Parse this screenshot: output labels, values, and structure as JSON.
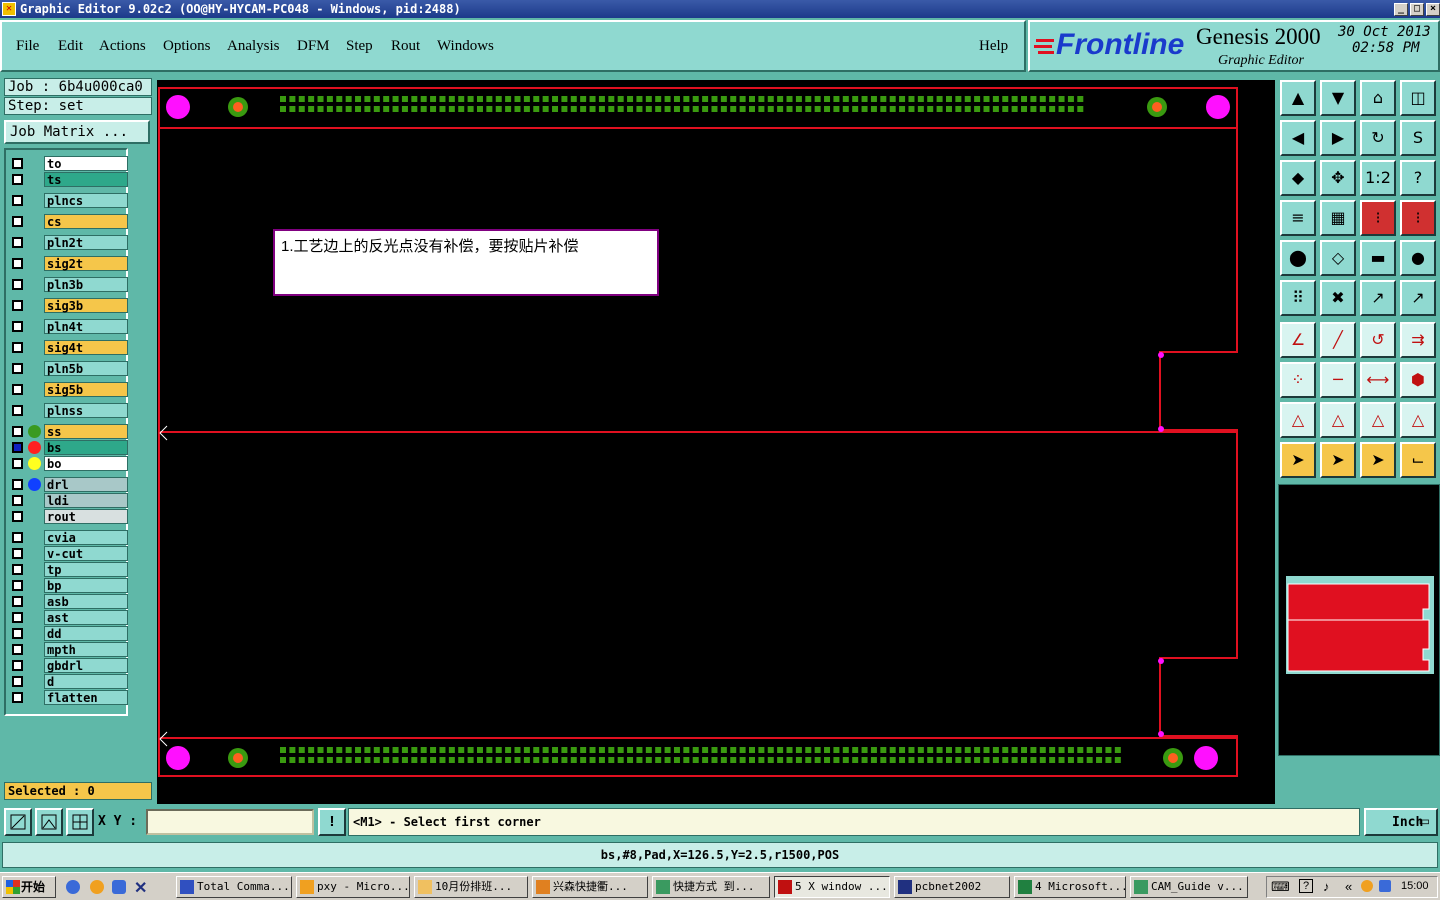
{
  "window": {
    "title": "Graphic Editor 9.02c2 (OO@HY-HYCAM-PC048 - Windows, pid:2488)"
  },
  "menu": {
    "items": [
      "File",
      "Edit",
      "Actions",
      "Options",
      "Analysis",
      "DFM",
      "Step",
      "Rout",
      "Windows"
    ],
    "help": "Help"
  },
  "brand": {
    "logo": "Frontline",
    "product": "Genesis 2000",
    "subtitle": "Graphic Editor",
    "date": "30 Oct 2013",
    "time": "02:58 PM"
  },
  "job": {
    "job_line": "Job :  6b4u000ca0",
    "step_line": "Step:  set",
    "matrix_button": "Job Matrix ..."
  },
  "layers": [
    {
      "name": "to",
      "color": "#ffffff",
      "dot": ""
    },
    {
      "name": "ts",
      "color": "#2ea88a",
      "dot": ""
    },
    {
      "name": "plncs",
      "color": "#8fd9d0",
      "dot": ""
    },
    {
      "name": "cs",
      "color": "#f5c64a",
      "dot": ""
    },
    {
      "name": "pln2t",
      "color": "#8fd9d0",
      "dot": ""
    },
    {
      "name": "sig2t",
      "color": "#f5c64a",
      "dot": ""
    },
    {
      "name": "pln3b",
      "color": "#8fd9d0",
      "dot": ""
    },
    {
      "name": "sig3b",
      "color": "#f5c64a",
      "dot": ""
    },
    {
      "name": "pln4t",
      "color": "#8fd9d0",
      "dot": ""
    },
    {
      "name": "sig4t",
      "color": "#f5c64a",
      "dot": ""
    },
    {
      "name": "pln5b",
      "color": "#8fd9d0",
      "dot": ""
    },
    {
      "name": "sig5b",
      "color": "#f5c64a",
      "dot": ""
    },
    {
      "name": "plnss",
      "color": "#8fd9d0",
      "dot": ""
    },
    {
      "name": "ss",
      "color": "#f5c64a",
      "dot": "#3a9a20"
    },
    {
      "name": "bs",
      "color": "#2ea88a",
      "dot": "#ff2020"
    },
    {
      "name": "bo",
      "color": "#ffffff",
      "dot": "#ffff20"
    },
    {
      "name": "drl",
      "color": "#a8c8c8",
      "dot": "#1040ff"
    },
    {
      "name": "ldi",
      "color": "#a8c8c8",
      "dot": ""
    },
    {
      "name": "rout",
      "color": "#d8e0e0",
      "dot": ""
    },
    {
      "name": "cvia",
      "color": "#8fd9d0",
      "dot": ""
    },
    {
      "name": "v-cut",
      "color": "#8fd9d0",
      "dot": ""
    },
    {
      "name": "tp",
      "color": "#8fd9d0",
      "dot": ""
    },
    {
      "name": "bp",
      "color": "#8fd9d0",
      "dot": ""
    },
    {
      "name": "asb",
      "color": "#8fd9d0",
      "dot": ""
    },
    {
      "name": "ast",
      "color": "#8fd9d0",
      "dot": ""
    },
    {
      "name": "dd",
      "color": "#8fd9d0",
      "dot": ""
    },
    {
      "name": "mpth",
      "color": "#8fd9d0",
      "dot": ""
    },
    {
      "name": "gbdrl",
      "color": "#8fd9d0",
      "dot": ""
    },
    {
      "name": "d",
      "color": "#8fd9d0",
      "dot": ""
    },
    {
      "name": "flatten",
      "color": "#8fd9d0",
      "dot": ""
    }
  ],
  "selected": "Selected : 0",
  "note": "1.工艺边上的反光点没有补偿，要按贴片补偿",
  "status": {
    "xy_label": "X Y :",
    "xy_value": "",
    "prompt": "<M1> - Select first corner",
    "units": "Inch"
  },
  "message": "bs,#8,Pad,X=126.5,Y=2.5,r1500,POS",
  "taskbar": {
    "start": "开始",
    "tasks": [
      "Total Comma...",
      "pxy - Micro...",
      "10月份排班...",
      "兴森快捷衢...",
      "快捷方式 到...",
      "5 X window ...",
      "pcbnet2002",
      "4 Microsoft...",
      "CAM_Guide v..."
    ],
    "clock": "15:00"
  },
  "colors": {
    "board_outline": "#e01020",
    "pad_green": "#3a9a10",
    "fiducial": "#ff10ff",
    "panel": "#5fb8a8",
    "panel_light": "#8fd9d0"
  }
}
